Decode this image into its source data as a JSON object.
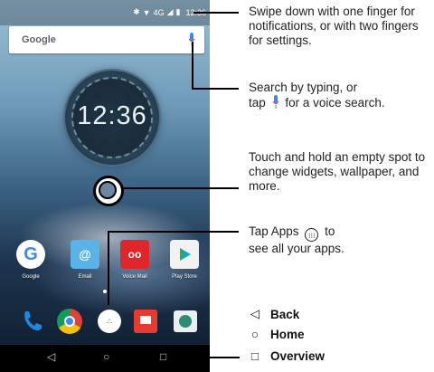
{
  "status_bar": {
    "bluetooth": "bluetooth-icon",
    "wifi": "wifi-icon",
    "network": "4G",
    "time": "12:36"
  },
  "search_bar": {
    "logo": "Google",
    "mic_icon": "mic-icon"
  },
  "clock_widget": {
    "time": "12:36"
  },
  "apps": [
    {
      "label": "Google",
      "color": "#ffffff"
    },
    {
      "label": "Email",
      "color": "#5ab3e6"
    },
    {
      "label": "Voice Mail",
      "color": "#e0262b"
    },
    {
      "label": "Play Store",
      "color": "#f2f2f2"
    }
  ],
  "dock": [
    {
      "name": "phone",
      "color": "#1d87e4"
    },
    {
      "name": "chrome",
      "color": "#f4c20d"
    },
    {
      "name": "apps",
      "color": "#ffffff"
    },
    {
      "name": "messages",
      "color": "#e83b2f"
    },
    {
      "name": "camera",
      "color": "#e9eef0"
    }
  ],
  "callouts": {
    "notifications": "Swipe down with one finger for notifications, or with two fingers for settings.",
    "search_line1": "Search by typing, or",
    "search_line2_pre": "tap",
    "search_line2_post": "for a voice search.",
    "widgets": "Touch and hold an empty spot to change widgets, wallpaper, and more.",
    "apps_line1_pre": "Tap Apps",
    "apps_line1_post": "to",
    "apps_line2": "see all your apps."
  },
  "nav_legend": {
    "back": "Back",
    "home": "Home",
    "overview": "Overview"
  }
}
